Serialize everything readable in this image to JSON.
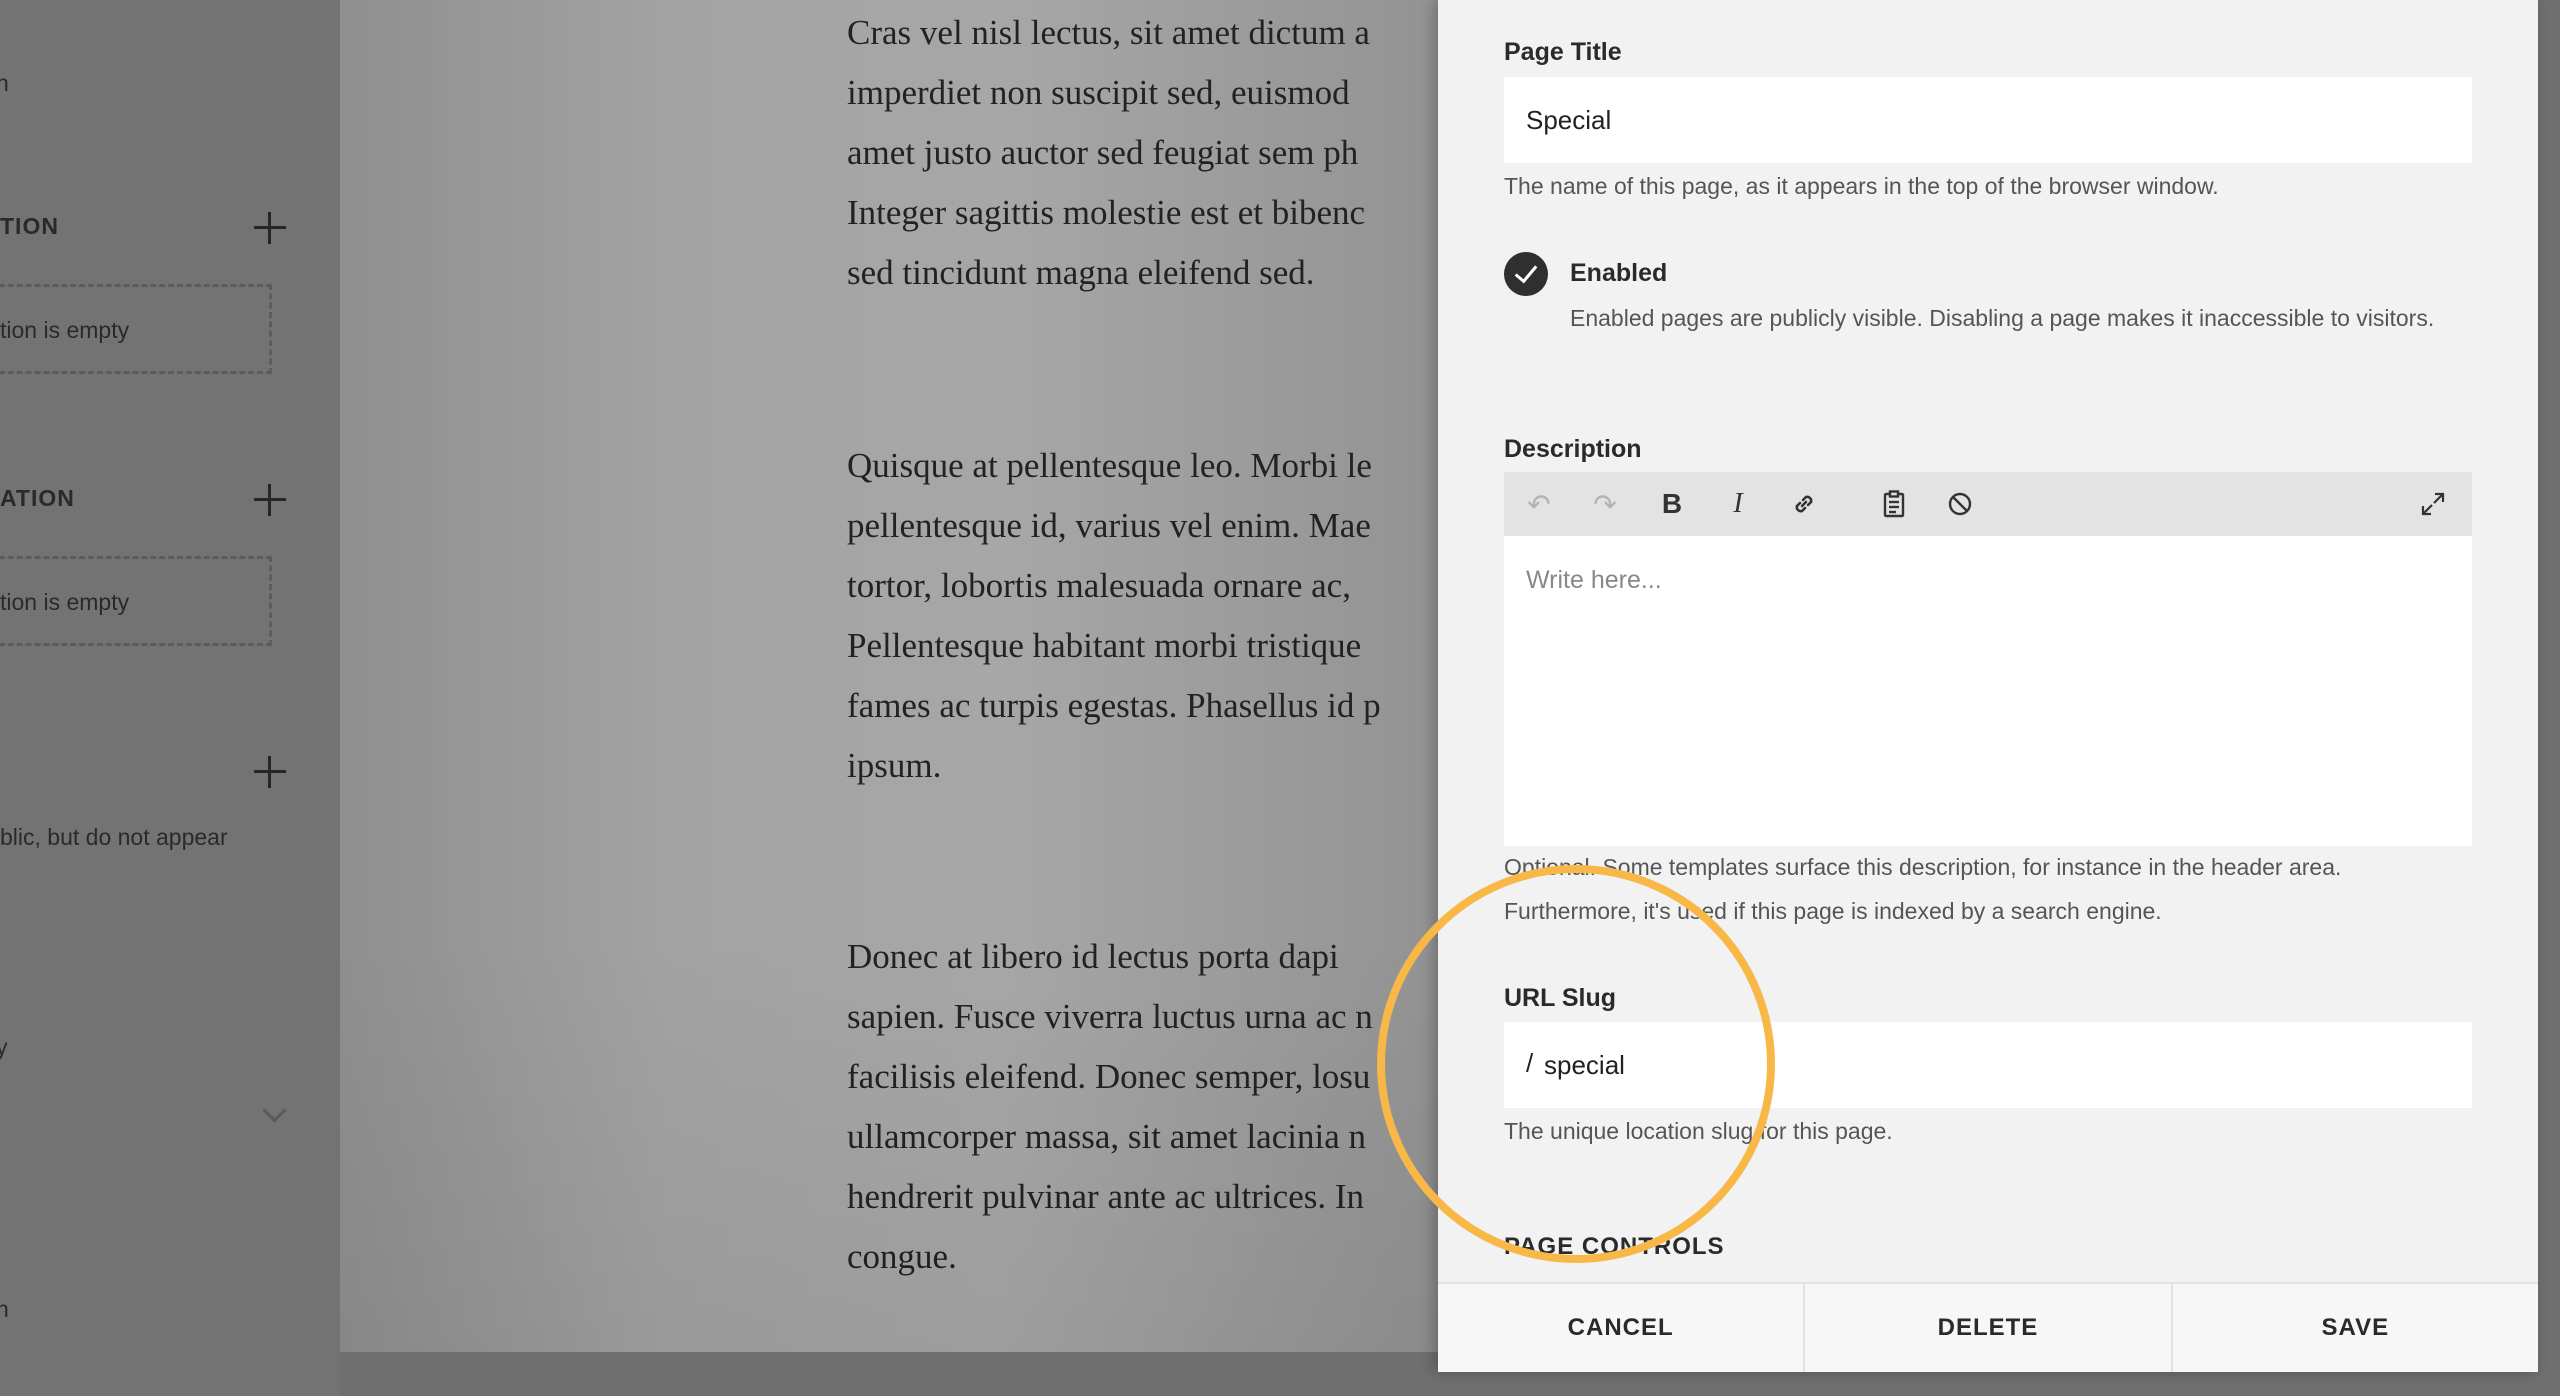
{
  "sidebar": {
    "fragments": [
      "n",
      "y",
      "n"
    ],
    "section_1": {
      "heading": "TION",
      "empty_text": "tion is empty"
    },
    "section_2": {
      "heading": "ATION",
      "empty_text": "tion is empty"
    },
    "section_3": {
      "note": "blic, but do not appear"
    }
  },
  "preview": {
    "paragraphs": [
      [
        "Cras vel nisl lectus, sit amet dictum a",
        "imperdiet non suscipit sed, euismod",
        "amet justo auctor sed feugiat sem ph",
        "Integer sagittis molestie est et bibenc",
        "sed tincidunt magna eleifend sed."
      ],
      [
        "Quisque at pellentesque leo. Morbi le",
        "pellentesque id, varius vel enim. Mae",
        "tortor, lobortis malesuada ornare ac,",
        "Pellentesque habitant morbi tristique",
        "fames ac turpis egestas. Phasellus id p",
        "ipsum."
      ],
      [
        "Donec at libero id lectus porta dapi",
        "sapien. Fusce viverra luctus urna ac n",
        "facilisis eleifend. Donec semper, losu",
        "ullamcorper massa, sit amet lacinia n",
        "hendrerit pulvinar ante ac ultrices. In",
        "congue."
      ]
    ]
  },
  "panel": {
    "page_title": {
      "label": "Page Title",
      "value": "Special",
      "help": "The name of this page, as it appears in the top of the browser window."
    },
    "enabled": {
      "label": "Enabled",
      "checked": true,
      "help": "Enabled pages are publicly visible. Disabling a page makes it inaccessible to visitors."
    },
    "description": {
      "label": "Description",
      "placeholder": "Write here...",
      "toolbar": [
        "undo-icon",
        "redo-icon",
        "bold-icon",
        "italic-icon",
        "link-icon",
        "clipboard-icon",
        "clear-format-icon",
        "expand-icon"
      ],
      "help": "Optional. Some templates surface this description, for instance in the header area. Furthermore, it's used if this page is indexed by a search engine."
    },
    "url_slug": {
      "label": "URL Slug",
      "prefix": "/",
      "value": "special",
      "help": "The unique location slug for this page."
    },
    "page_controls_heading": "PAGE CONTROLS",
    "footer": {
      "cancel": "CANCEL",
      "delete": "DELETE",
      "save": "SAVE"
    }
  },
  "colors": {
    "highlight": "#f7b847",
    "panel_bg": "#f2f2f2",
    "checkbox": "#2f2f2f"
  }
}
